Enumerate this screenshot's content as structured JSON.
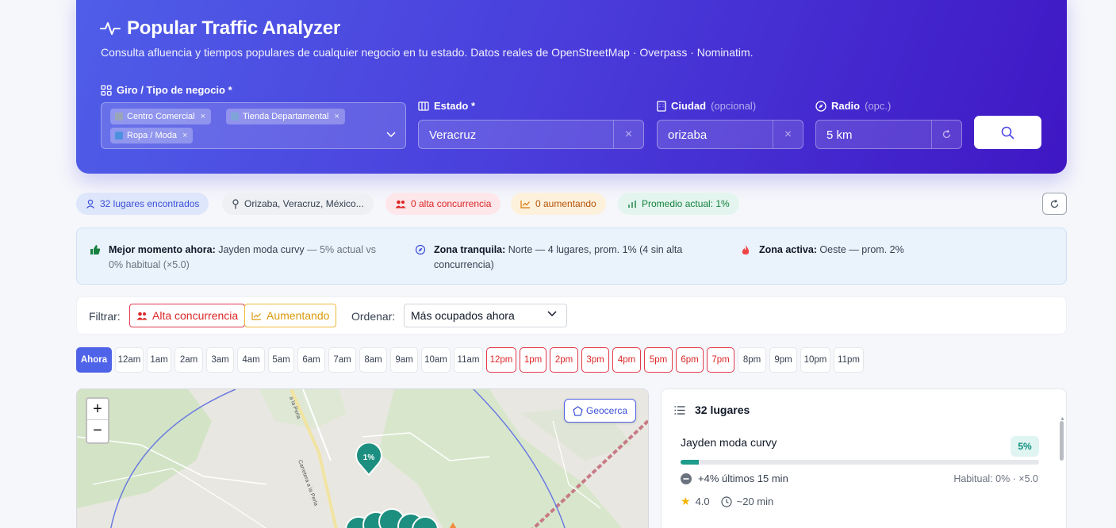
{
  "header": {
    "title": "Popular Traffic Analyzer",
    "subtitle": "Consulta afluencia y tiempos populares de cualquier negocio en tu estado. Datos reales de OpenStreetMap · Overpass · Nominatim."
  },
  "form": {
    "giro": {
      "label": "Giro / Tipo de negocio *",
      "chips": [
        {
          "label": "Centro Comercial",
          "remove": "×"
        },
        {
          "label": "Tienda Departamental",
          "remove": "×"
        },
        {
          "label": "Ropa / Moda",
          "remove": "×"
        }
      ]
    },
    "estado": {
      "label": "Estado *",
      "value": "Veracruz",
      "clear": "×"
    },
    "ciudad": {
      "label": "Ciudad",
      "optional": "(opcional)",
      "value": "orizaba",
      "clear": "×"
    },
    "radio": {
      "label": "Radio",
      "optional": "(opc.)",
      "value": "5 km"
    }
  },
  "stats": {
    "found": "32 lugares encontrados",
    "location": "Orizaba, Veracruz, México...",
    "high": "0 alta concurrencia",
    "rising": "0 aumentando",
    "average": "Promedio actual: 1%"
  },
  "insights": {
    "best": {
      "label": "Mejor momento ahora:",
      "text": "Jayden moda curvy",
      "detail": "— 5% actual vs",
      "detail2": "0% habitual (×5.0)"
    },
    "quiet": {
      "label": "Zona tranquila:",
      "text": "Norte — 4 lugares, prom. 1% (4 sin alta",
      "text2": "concurrencia)"
    },
    "active": {
      "label": "Zona activa:",
      "text": "Oeste — prom. 2%"
    }
  },
  "filters": {
    "filter_label": "Filtrar:",
    "high_btn": "Alta concurrencia",
    "rising_btn": "Aumentando",
    "sort_label": "Ordenar:",
    "sort_value": "Más ocupados ahora"
  },
  "hours": [
    "Ahora",
    "12am",
    "1am",
    "2am",
    "3am",
    "4am",
    "5am",
    "6am",
    "7am",
    "8am",
    "9am",
    "10am",
    "11am",
    "12pm",
    "1pm",
    "2pm",
    "3pm",
    "4pm",
    "5pm",
    "6pm",
    "7pm",
    "8pm",
    "9pm",
    "10pm",
    "11pm"
  ],
  "peak_hours": [
    "12pm",
    "1pm",
    "2pm",
    "3pm",
    "4pm",
    "5pm",
    "6pm",
    "7pm"
  ],
  "map": {
    "zoom_in": "+",
    "zoom_out": "−",
    "geocerca": "Geocerca",
    "marker_label": "1%",
    "street_label_1": "Carretera a la Perla",
    "street_label_2": "a la Perla"
  },
  "list": {
    "title": "32 lugares",
    "first": {
      "name": "Jayden moda curvy",
      "pct": "5%",
      "fill": 0.05,
      "trend": "+4% últimos 15 min",
      "habitual": "Habitual: 0% · ×5.0",
      "rating": "4.0",
      "time": "~20 min"
    }
  },
  "colors": {
    "accent": "#4f63e8",
    "peak": "#dc2626",
    "teal": "#1d9b8b"
  }
}
